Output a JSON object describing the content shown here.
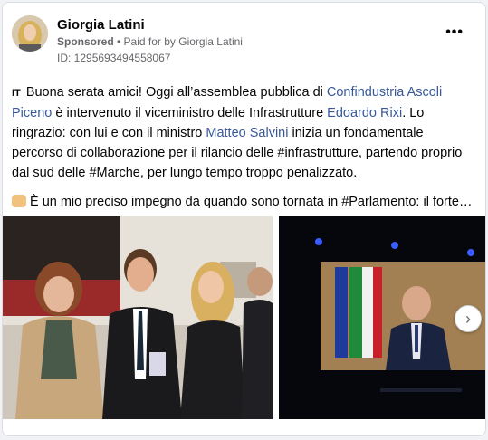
{
  "post": {
    "author": "Giorgia Latini",
    "sponsored_label": "Sponsored",
    "paid_for_by": "• Paid for by Giorgia Latini",
    "ad_id": "ID: 1295693494558067",
    "menu_icon": "more-dots-icon"
  },
  "body": {
    "flag": "IT",
    "p1_a": "Buona serata amici! Oggi all’assemblea pubblica di ",
    "link1": "Confindustria Ascoli Piceno",
    "p1_b": " è intervenuto il viceministro delle Infrastrutture ",
    "link2": "Edoardo Rixi",
    "p1_c": ". Lo ringrazio: con lui e con il ministro ",
    "link3": "Matteo Salvini",
    "p1_d": " inizia un fondamentale percorso di collaborazione per il rilancio delle #infrastrutture, partendo proprio dal sud delle #Marche, per lungo tempo troppo penalizzato.",
    "p2": "È un mio preciso impegno da quando sono tornata in #Parlamento: il forte…"
  },
  "carousel": {
    "next_icon": "chevron-right-icon",
    "next_glyph": "›"
  },
  "colors": {
    "link": "#385898",
    "meta": "#65676b"
  }
}
